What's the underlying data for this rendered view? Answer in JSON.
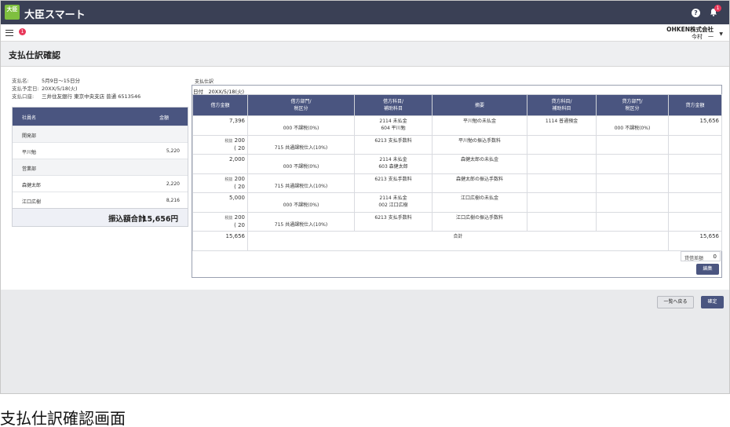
{
  "app": {
    "logo_text": "大臣",
    "title": "大臣スマート",
    "help_glyph": "?",
    "notifications": "1",
    "menu_badge": "1",
    "company": "OHKEN株式会社",
    "user": "今村　一"
  },
  "page": {
    "title": "支払仕訳確認"
  },
  "info": {
    "payment_name_label": "支払名:",
    "payment_name": "5月9日〜15日分",
    "planned_date_label": "支払予定日:",
    "planned_date": "20XX/5/18(火)",
    "bank_label": "支払口座:",
    "bank": "三井住友銀行 東京中央支店 普通 6513546"
  },
  "employee_table": {
    "col_name": "社員名",
    "col_amount": "金額",
    "rows": [
      {
        "name": "開発部",
        "amount": "",
        "group": true
      },
      {
        "name": "平川勉",
        "amount": "5,220",
        "group": false
      },
      {
        "name": "営業部",
        "amount": "",
        "group": true
      },
      {
        "name": "森健太郎",
        "amount": "2,220",
        "group": false
      },
      {
        "name": "江口広樹",
        "amount": "8,216",
        "group": false
      }
    ],
    "total_label": "振込額合計",
    "total_value": "15,656円"
  },
  "journal": {
    "label": "支払仕訳",
    "date": "日付　20XX/5/18(火)",
    "headers": {
      "debit_amount": "借方金額",
      "debit_dept": "借方部門/",
      "debit_tax": "税区分",
      "debit_account": "借方科目/",
      "debit_sub": "補助科目",
      "summary": "摘要",
      "credit_account": "貸方科目/",
      "credit_sub": "補助科目",
      "credit_dept": "貸方部門/",
      "credit_tax": "税区分",
      "credit_amount": "貸方金額"
    },
    "rows": [
      {
        "amt": "7,396",
        "amt2": "",
        "tax_pre": "",
        "dtax": "000 不課税(0%)",
        "dacc": "2114 未払金",
        "dsub": "604 平川勉",
        "summary": "平川勉の未払金",
        "cacc": "1114 普通預金",
        "ctax": "000 不課税(0%)",
        "camt": "15,656"
      },
      {
        "amt": "200",
        "amt2": "( 20",
        "tax_pre": "税抜",
        "dtax": "715 共通課税仕入(10%)",
        "dacc": "6213 支払手数料",
        "dsub": "",
        "summary": "平川勉の振込手数料",
        "cacc": "",
        "ctax": "",
        "camt": ""
      },
      {
        "amt": "2,000",
        "amt2": "",
        "tax_pre": "",
        "dtax": "000 不課税(0%)",
        "dacc": "2114 未払金",
        "dsub": "603 森健太郎",
        "summary": "森健太郎の未払金",
        "cacc": "",
        "ctax": "",
        "camt": ""
      },
      {
        "amt": "200",
        "amt2": "( 20",
        "tax_pre": "税抜",
        "dtax": "715 共通課税仕入(10%)",
        "dacc": "6213 支払手数料",
        "dsub": "",
        "summary": "森健太郎の振込手数料",
        "cacc": "",
        "ctax": "",
        "camt": ""
      },
      {
        "amt": "5,000",
        "amt2": "",
        "tax_pre": "",
        "dtax": "000 不課税(0%)",
        "dacc": "2114 未払金",
        "dsub": "002 江口広樹",
        "summary": "江口広樹の未払金",
        "cacc": "",
        "ctax": "",
        "camt": ""
      },
      {
        "amt": "200",
        "amt2": "( 20",
        "tax_pre": "税抜",
        "dtax": "715 共通課税仕入(10%)",
        "dacc": "6213 支払手数料",
        "dsub": "",
        "summary": "江口広樹の振込手数料",
        "cacc": "",
        "ctax": "",
        "camt": ""
      }
    ],
    "total_debit": "15,656",
    "total_label": "合計",
    "total_credit": "15,656",
    "diff_label": "貸借差額",
    "diff_value": "0",
    "edit_button": "編集"
  },
  "footer": {
    "back_button": "一覧へ戻る",
    "confirm_button": "確定"
  },
  "caption": "支払仕訳確認画面"
}
